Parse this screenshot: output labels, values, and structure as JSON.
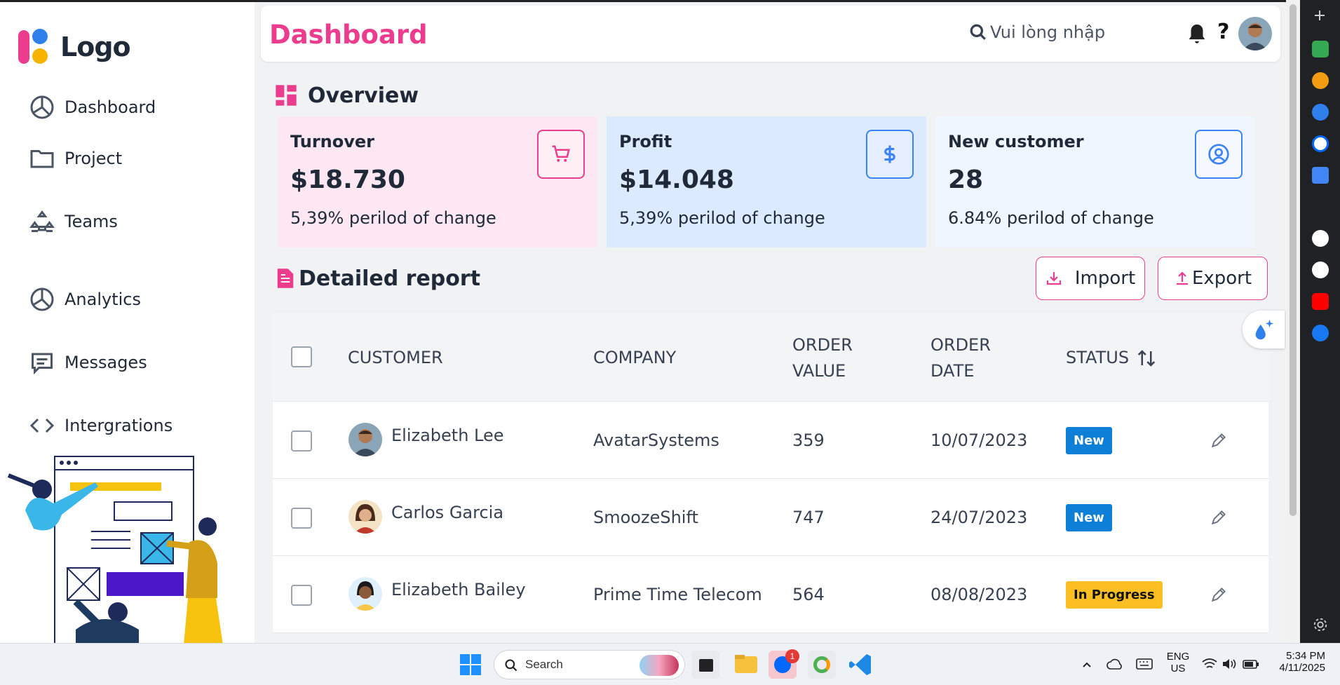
{
  "app": {
    "logo_text": "Logo",
    "page_title": "Dashboard"
  },
  "header": {
    "search_placeholder": "Vui lòng nhập",
    "help_label": "?"
  },
  "sidebar": {
    "items": [
      {
        "label": "Dashboard",
        "icon": "pie-chart-icon"
      },
      {
        "label": "Project",
        "icon": "folder-icon"
      },
      {
        "label": "Teams",
        "icon": "teams-icon"
      },
      {
        "label": "Analytics",
        "icon": "pie-chart-icon"
      },
      {
        "label": "Messages",
        "icon": "message-icon"
      },
      {
        "label": "Intergrations",
        "icon": "code-icon"
      }
    ]
  },
  "overview": {
    "title": "Overview",
    "cards": [
      {
        "label": "Turnover",
        "value": "$18.730",
        "change": "5,39% perilod of change",
        "icon": "cart-icon",
        "bg": "#fce7f3",
        "accent": "#ec3c8e"
      },
      {
        "label": "Profit",
        "value": "$14.048",
        "change": "5,39% perilod of change",
        "icon": "dollar-icon",
        "bg": "#dbeafe",
        "accent": "#3b82f6"
      },
      {
        "label": "New customer",
        "value": "28",
        "change": "6.84% perilod of change",
        "icon": "user-circle-icon",
        "bg": "#eff6ff",
        "accent": "#3b82f6"
      }
    ]
  },
  "report": {
    "title": "Detailed report",
    "import_label": "Import",
    "export_label": "Export",
    "columns": {
      "customer": "CUSTOMER",
      "company": "COMPANY",
      "order_value_1": "ORDER",
      "order_value_2": "VALUE",
      "order_date_1": "ORDER",
      "order_date_2": "DATE",
      "status": "STATUS"
    },
    "rows": [
      {
        "customer": "Elizabeth Lee",
        "company": "AvatarSystems",
        "order_value": "359",
        "order_date": "10/07/2023",
        "status": "New"
      },
      {
        "customer": "Carlos Garcia",
        "company": "SmoozeShift",
        "order_value": "747",
        "order_date": "24/07/2023",
        "status": "New"
      },
      {
        "customer": "Elizabeth Bailey",
        "company": "Prime Time Telecom",
        "order_value": "564",
        "order_date": "08/08/2023",
        "status": "In Progress"
      }
    ]
  },
  "colors": {
    "brand_pink": "#ec3c8e",
    "status_new": "#0d7fd6",
    "status_in_progress": "#fbbf24"
  },
  "taskbar": {
    "search_label": "Search",
    "zalo_badge": "1",
    "lang_1": "ENG",
    "lang_2": "US",
    "time": "5:34 PM",
    "date": "4/11/2025"
  }
}
